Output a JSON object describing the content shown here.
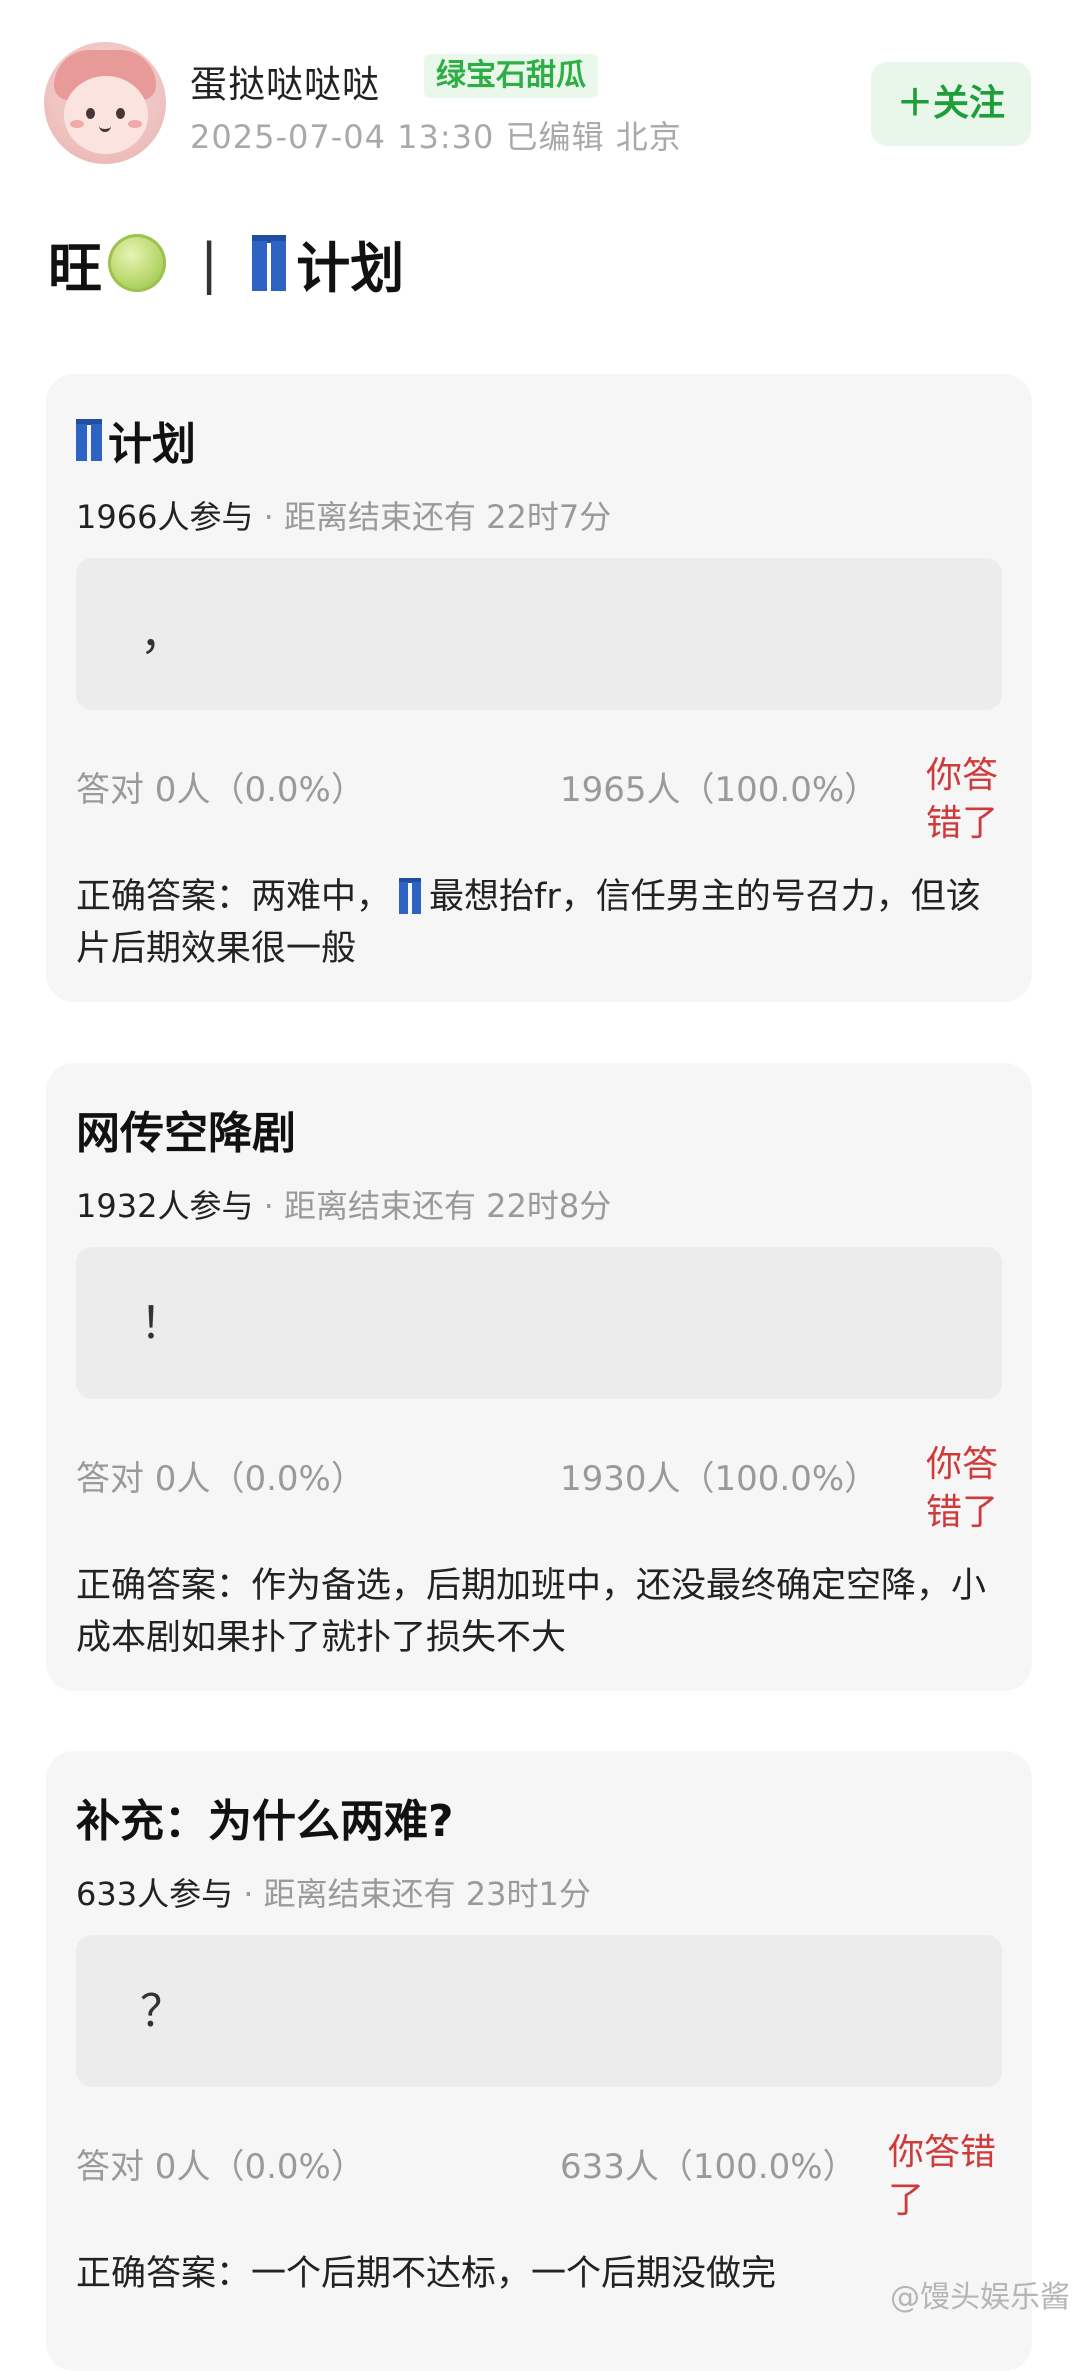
{
  "header": {
    "username": "蛋挞哒哒哒",
    "badge": "绿宝石甜瓜",
    "meta": "2025-07-04 13:30  已编辑  北京",
    "follow": "＋关注"
  },
  "post": {
    "title_left": "旺",
    "separator": "|",
    "title_right": "计划"
  },
  "icons": [
    "avatar",
    "melon-emoji",
    "jeans-emoji"
  ],
  "polls": [
    {
      "title": "计划",
      "participants": "1966人参与",
      "countdown": " · 距离结束还有 22时7分",
      "option": "，",
      "correct": "答对  0人（0.0%）",
      "others": "1965人（100.0%）",
      "result": "你答错了",
      "answer_a": "正确答案：两难中，",
      "answer_b": "最想抬fr，信任男主的号召力，但该片后期效果很一般"
    },
    {
      "title": "网传空降剧",
      "participants": "1932人参与",
      "countdown": " · 距离结束还有 22时8分",
      "option": "！",
      "correct": "答对  0人（0.0%）",
      "others": "1930人（100.0%）",
      "result": "你答错了",
      "answer": "正确答案：作为备选，后期加班中，还没最终确定空降，小成本剧如果扑了就扑了损失不大"
    },
    {
      "title": "补充：为什么两难?",
      "participants": "633人参与",
      "countdown": " · 距离结束还有 23时1分",
      "option": "？",
      "correct": "答对  0人（0.0%）",
      "others": "633人（100.0%）",
      "result": "你答错了",
      "answer": "正确答案：一个后期不达标，一个后期没做完"
    }
  ],
  "watermark": "@馒头娱乐酱",
  "colors": {
    "accent_green": "#2fae48",
    "wrong_red": "#cf3a3a",
    "card_bg": "#f6f6f6"
  }
}
